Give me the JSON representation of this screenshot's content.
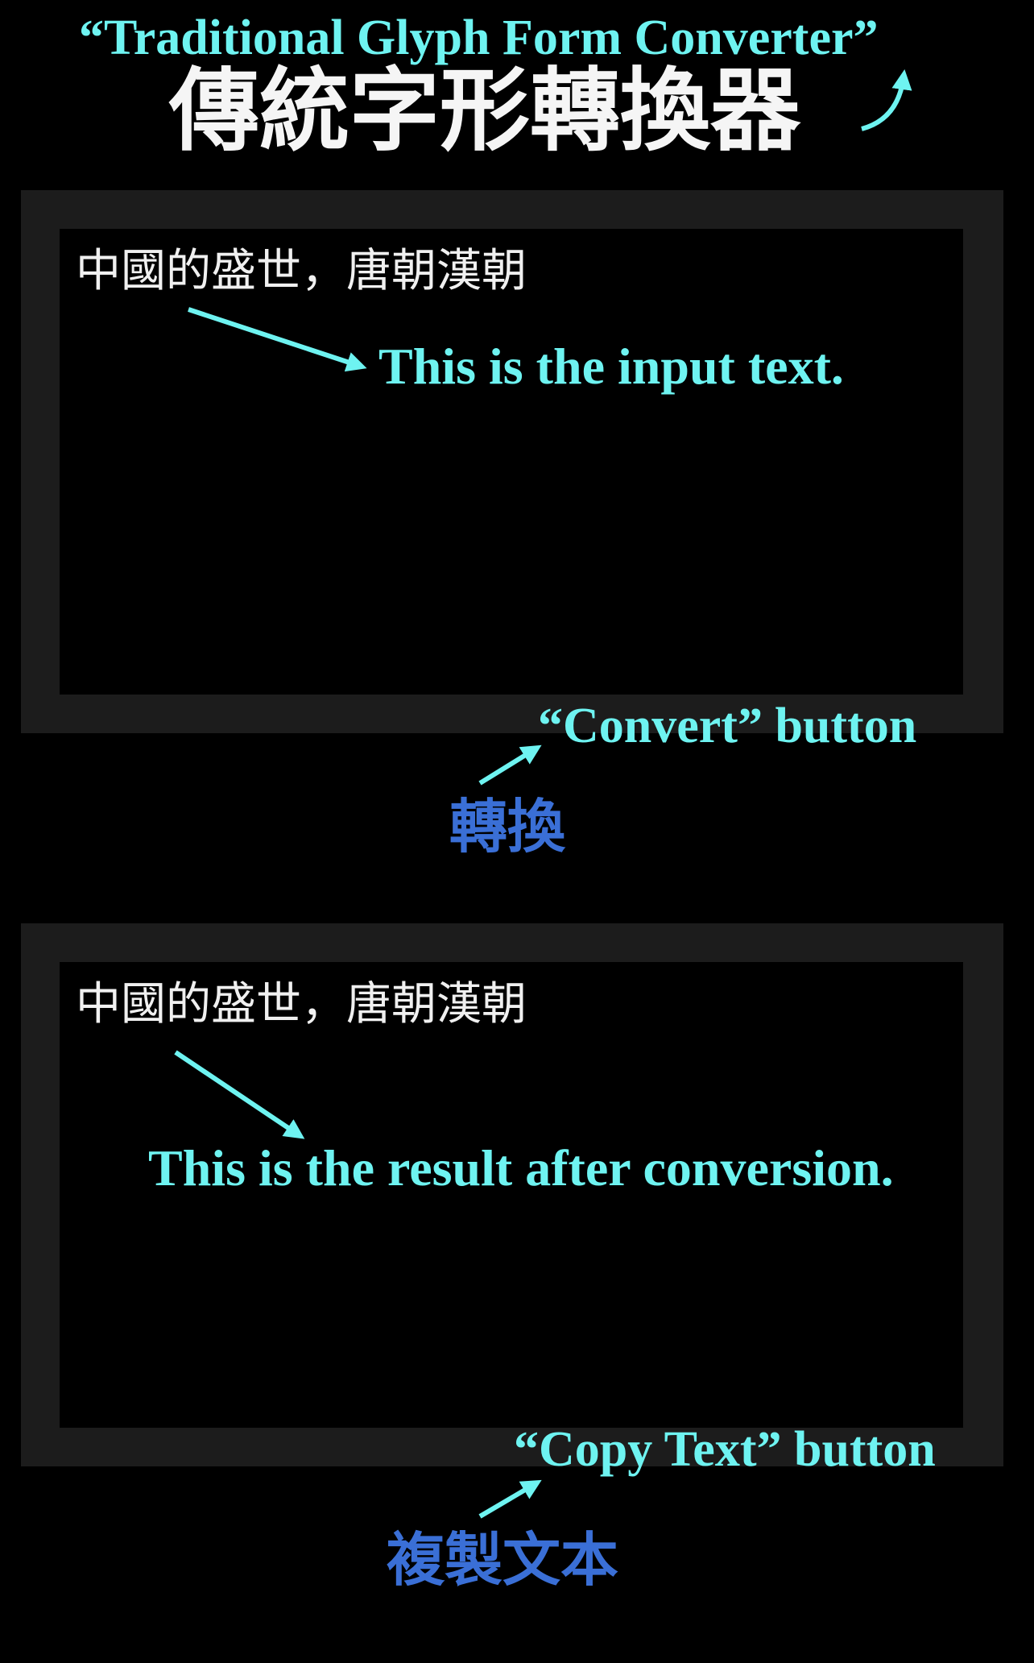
{
  "annotations": {
    "title_note": "“Traditional Glyph Form Converter”",
    "input_note": "This is the input text.",
    "convert_note": "“Convert” button",
    "result_note": "This is the result after conversion.",
    "copy_note": "“Copy Text” button"
  },
  "app": {
    "title": "傳統字形轉換器",
    "input_text": "中國的盛世，唐朝漢朝",
    "convert_button": "轉換",
    "output_text": "中國的盛世，唐朝漢朝",
    "copy_button": "複製文本"
  },
  "colors": {
    "background": "#000000",
    "panel": "#1c1c1c",
    "annotation": "#6ef3f1",
    "button_text": "#3a6fd6",
    "body_text": "#f0f0f0"
  },
  "icons": [
    "annotation-arrow-icon"
  ]
}
